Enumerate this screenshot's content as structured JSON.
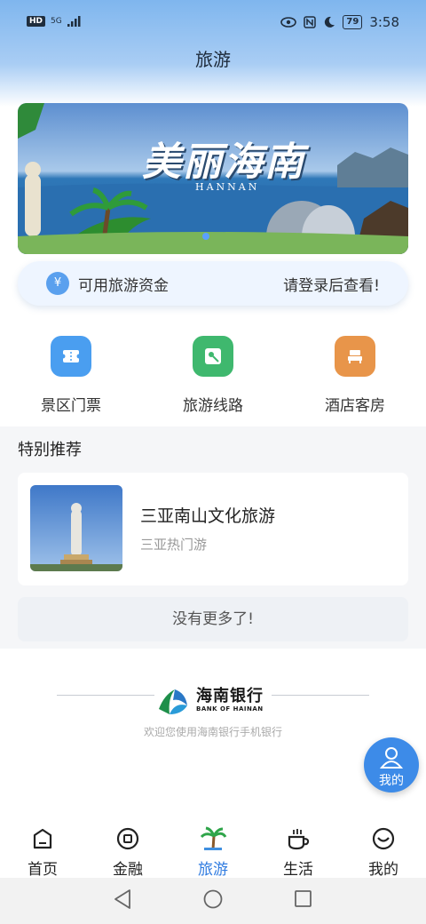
{
  "status_bar": {
    "hd": "HD",
    "signal": "5G",
    "battery": "79",
    "time": "3:58"
  },
  "page_title": "旅游",
  "banner": {
    "title": "美丽海南",
    "subtitle": "HANNAN"
  },
  "fund_bar": {
    "label": "可用旅游资金",
    "login_hint": "请登录后查看!",
    "icon": "yen-icon"
  },
  "quick_links": [
    {
      "label": "景区门票",
      "icon": "ticket-icon",
      "color": "#4a9ef0"
    },
    {
      "label": "旅游线路",
      "icon": "route-icon",
      "color": "#3fb86e"
    },
    {
      "label": "酒店客房",
      "icon": "hotel-bed-icon",
      "color": "#e8954a"
    }
  ],
  "recommend": {
    "section_title": "特别推荐",
    "items": [
      {
        "title": "三亚南山文化旅游",
        "subtitle": "三亚热门游"
      }
    ],
    "no_more": "没有更多了!"
  },
  "footer": {
    "bank_name": "海南银行",
    "bank_name_en": "BANK OF HAINAN",
    "welcome": "欢迎您使用海南银行手机银行"
  },
  "float_button": {
    "label": "我的"
  },
  "tabs": [
    {
      "label": "首页",
      "icon": "home-icon",
      "active": false
    },
    {
      "label": "金融",
      "icon": "finance-icon",
      "active": false
    },
    {
      "label": "旅游",
      "icon": "palm-tree-icon",
      "active": true
    },
    {
      "label": "生活",
      "icon": "coffee-cup-icon",
      "active": false
    },
    {
      "label": "我的",
      "icon": "smiley-icon",
      "active": false
    }
  ],
  "colors": {
    "accent": "#2f7be0",
    "header_top": "#7fb6ee"
  }
}
